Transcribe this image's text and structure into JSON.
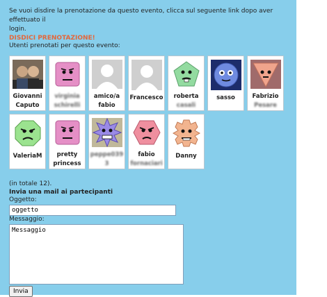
{
  "intro": {
    "line1": "Se vuoi disdire la prenotazione da questo evento, clicca sul seguente link dopo aver effettuato il",
    "line2": "login.",
    "cancel_link": "DISDICI PRENOTAZIONE!",
    "list_label": "Utenti prenotati per questo evento:"
  },
  "users": [
    {
      "name_line1": "Giovanni",
      "name_line2": "Caputo",
      "avatar": "photo-icon"
    },
    {
      "name_line1": "virginia",
      "name_line2": "schirelli",
      "avatar": "pink-square-face-icon",
      "blurred": true
    },
    {
      "name_line1": "amico/a",
      "name_line2": "fabio",
      "avatar": "default-user-icon"
    },
    {
      "name_line1": "Francesco",
      "name_line2": "",
      "avatar": "default-user-icon"
    },
    {
      "name_line1": "roberta",
      "name_line2": "casali",
      "avatar": "green-pentagon-face-icon",
      "blurred_line2": true
    },
    {
      "name_line1": "sasso",
      "name_line2": "",
      "avatar": "blue-circle-face-icon"
    },
    {
      "name_line1": "Fabrizio",
      "name_line2": "Pesare",
      "avatar": "orange-triangle-face-icon",
      "blurred_line2": true
    },
    {
      "name_line1": "ValeriaM",
      "name_line2": "",
      "avatar": "green-octagon-face-icon"
    },
    {
      "name_line1": "pretty",
      "name_line2": "princess",
      "avatar": "pink-square-face-icon"
    },
    {
      "name_line1": "peppe0393",
      "name_line2": "",
      "avatar": "purple-star-face-icon",
      "blurred": true
    },
    {
      "name_line1": "fabio",
      "name_line2": "fornaciari",
      "avatar": "pink-hexagon-face-icon",
      "blurred_line2": true
    },
    {
      "name_line1": "Danny",
      "name_line2": "",
      "avatar": "peach-gear-face-icon"
    }
  ],
  "total_text": "(in totale 12).",
  "mail": {
    "heading": "Invia una mail ai partecipanti",
    "subject_label": "Oggetto:",
    "subject_value": "oggetto",
    "message_label": "Messaggio:",
    "message_value": "Messaggio",
    "send_label": "Invia"
  },
  "colors": {
    "panel_bg": "#87ceeb",
    "cancel_link": "#e3673b"
  }
}
